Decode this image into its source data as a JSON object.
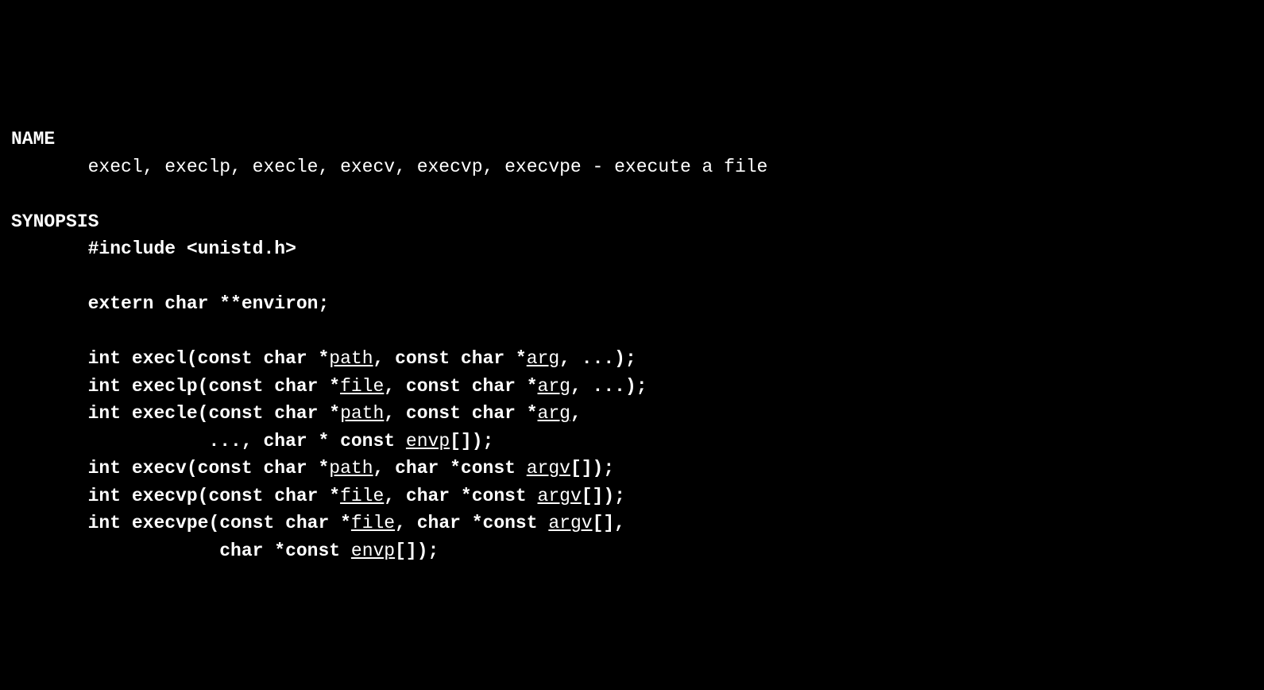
{
  "sections": {
    "name": {
      "header": "NAME",
      "content": "execl, execlp, execle, execv, execvp, execvpe - execute a file"
    },
    "synopsis": {
      "header": "SYNOPSIS",
      "include": "#include <unistd.h>",
      "extern": "extern char **environ;",
      "funcs": {
        "f1": {
          "pre": "int execl(const char *",
          "arg1": "path",
          "mid": ", const char *",
          "arg2": "arg",
          "post": ", ...);"
        },
        "f2": {
          "pre": "int execlp(const char *",
          "arg1": "file",
          "mid": ", const char *",
          "arg2": "arg",
          "post": ", ...);"
        },
        "f3a": {
          "pre": "int execle(const char *",
          "arg1": "path",
          "mid": ", const char *",
          "arg2": "arg",
          "post": ","
        },
        "f3b": {
          "pre": "..., char * const ",
          "arg1": "envp",
          "post": "[]);"
        },
        "f4": {
          "pre": "int execv(const char *",
          "arg1": "path",
          "mid": ", char *const ",
          "arg2": "argv",
          "post": "[]);"
        },
        "f5": {
          "pre": "int execvp(const char *",
          "arg1": "file",
          "mid": ", char *const ",
          "arg2": "argv",
          "post": "[]);"
        },
        "f6a": {
          "pre": "int execvpe(const char *",
          "arg1": "file",
          "mid": ", char *const ",
          "arg2": "argv",
          "post": "[],"
        },
        "f6b": {
          "pre": "char *const ",
          "arg1": "envp",
          "post": "[]);"
        }
      }
    }
  }
}
